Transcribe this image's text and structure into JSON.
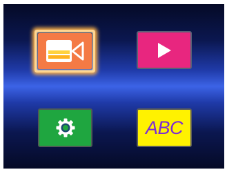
{
  "menu": {
    "items": [
      {
        "id": "camera",
        "icon": "video-camera-icon",
        "color": "#f47a45",
        "selected": true
      },
      {
        "id": "playback",
        "icon": "play-icon",
        "color": "#e8267f",
        "selected": false
      },
      {
        "id": "settings",
        "icon": "gear-icon",
        "color": "#1fa640",
        "selected": false
      },
      {
        "id": "language",
        "icon": "abc-text-icon",
        "color": "#fff200",
        "label": "ABC",
        "label_color": "#7b2bd6",
        "selected": false
      }
    ]
  },
  "colors": {
    "background_dark": "#050a26",
    "background_band": "#3c63e6",
    "selection_glow": "#ffb347"
  }
}
